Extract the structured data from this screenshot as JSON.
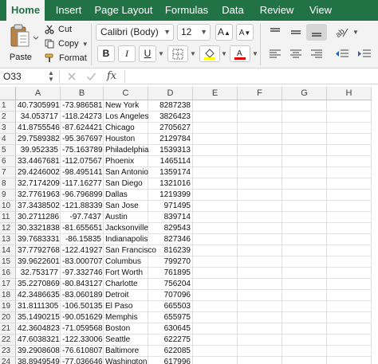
{
  "ribbon": {
    "tabs": [
      {
        "label": "Home",
        "active": true
      },
      {
        "label": "Insert",
        "active": false
      },
      {
        "label": "Page Layout",
        "active": false
      },
      {
        "label": "Formulas",
        "active": false
      },
      {
        "label": "Data",
        "active": false
      },
      {
        "label": "Review",
        "active": false
      },
      {
        "label": "View",
        "active": false
      }
    ],
    "paste_label": "Paste",
    "cut_label": "Cut",
    "copy_label": "Copy",
    "format_label": "Format",
    "font_name": "Calibri (Body)",
    "font_size": "12",
    "bold": "B",
    "italic": "I",
    "underline": "U",
    "fill_color": "#ffff00",
    "font_color": "#e00000",
    "accent": "#217346"
  },
  "formula_bar": {
    "name_box": "O33",
    "fx_label": "fx",
    "content": ""
  },
  "sheet": {
    "columns": [
      "A",
      "B",
      "C",
      "D",
      "E",
      "F",
      "G",
      "H"
    ],
    "rows": [
      {
        "n": "1",
        "a": "40.7305991",
        "b": "-73.986581",
        "c": "New York",
        "d": "8287238"
      },
      {
        "n": "2",
        "a": "34.053717",
        "b": "-118.24273",
        "c": "Los Angeles",
        "d": "3826423"
      },
      {
        "n": "3",
        "a": "41.8755546",
        "b": "-87.624421",
        "c": "Chicago",
        "d": "2705627"
      },
      {
        "n": "4",
        "a": "29.7589382",
        "b": "-95.367697",
        "c": "Houston",
        "d": "2129784"
      },
      {
        "n": "5",
        "a": "39.952335",
        "b": "-75.163789",
        "c": "Philadelphia",
        "d": "1539313"
      },
      {
        "n": "6",
        "a": "33.4467681",
        "b": "-112.07567",
        "c": "Phoenix",
        "d": "1465114"
      },
      {
        "n": "7",
        "a": "29.4246002",
        "b": "-98.495141",
        "c": "San Antonio",
        "d": "1359174"
      },
      {
        "n": "8",
        "a": "32.7174209",
        "b": "-117.16277",
        "c": "San Diego",
        "d": "1321016"
      },
      {
        "n": "9",
        "a": "32.7761963",
        "b": "-96.796899",
        "c": "Dallas",
        "d": "1219399"
      },
      {
        "n": "10",
        "a": "37.3438502",
        "b": "-121.88339",
        "c": "San Jose",
        "d": "971495"
      },
      {
        "n": "11",
        "a": "30.2711286",
        "b": "-97.7437",
        "c": "Austin",
        "d": "839714"
      },
      {
        "n": "12",
        "a": "30.3321838",
        "b": "-81.655651",
        "c": "Jacksonville",
        "d": "829543"
      },
      {
        "n": "13",
        "a": "39.7683331",
        "b": "-86.15835",
        "c": "Indianapolis",
        "d": "827346"
      },
      {
        "n": "14",
        "a": "37.7792768",
        "b": "-122.41927",
        "c": "San Francisco",
        "d": "816239"
      },
      {
        "n": "15",
        "a": "39.9622601",
        "b": "-83.000707",
        "c": "Columbus",
        "d": "799270"
      },
      {
        "n": "16",
        "a": "32.753177",
        "b": "-97.332746",
        "c": "Fort Worth",
        "d": "761895"
      },
      {
        "n": "17",
        "a": "35.2270869",
        "b": "-80.843127",
        "c": "Charlotte",
        "d": "756204"
      },
      {
        "n": "18",
        "a": "42.3486635",
        "b": "-83.060189",
        "c": "Detroit",
        "d": "707096"
      },
      {
        "n": "19",
        "a": "31.8111305",
        "b": "-106.50135",
        "c": "El Paso",
        "d": "665503"
      },
      {
        "n": "20",
        "a": "35.1490215",
        "b": "-90.051629",
        "c": "Memphis",
        "d": "655975"
      },
      {
        "n": "21",
        "a": "42.3604823",
        "b": "-71.059568",
        "c": "Boston",
        "d": "630645"
      },
      {
        "n": "22",
        "a": "47.6038321",
        "b": "-122.33006",
        "c": "Seattle",
        "d": "622275"
      },
      {
        "n": "23",
        "a": "39.2908608",
        "b": "-76.610807",
        "c": "Baltimore",
        "d": "622085"
      },
      {
        "n": "24",
        "a": "38.8949549",
        "b": "-77.036646",
        "c": "Washington",
        "d": "617996"
      }
    ]
  }
}
